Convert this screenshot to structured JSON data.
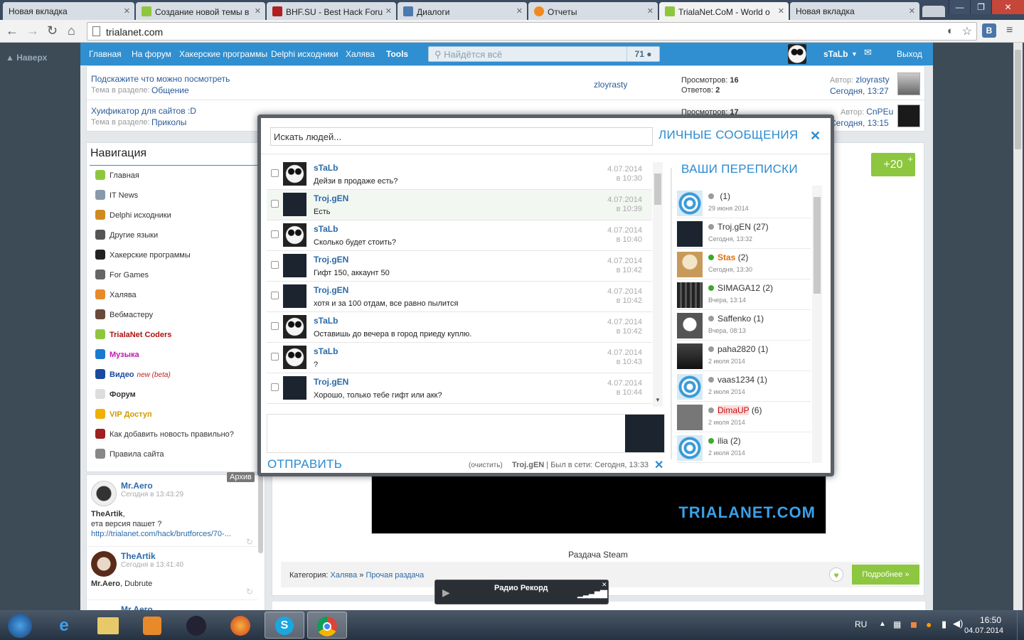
{
  "browser": {
    "tabs": [
      {
        "title": "Новая вкладка"
      },
      {
        "title": "Создание новой темы в"
      },
      {
        "title": "BHF.SU - Best Hack Foru"
      },
      {
        "title": "Диалоги"
      },
      {
        "title": "Отчеты"
      },
      {
        "title": "TrialaNet.CoM - World o"
      },
      {
        "title": "Новая вкладка"
      }
    ],
    "url": "trialanet.com",
    "ext_label": "В"
  },
  "site": {
    "back_to_top": "Наверх",
    "menu": [
      "Главная",
      "На форум",
      "Хакерские программы",
      "Delphi исходники",
      "Халява",
      "Tools"
    ],
    "search_placeholder": "Найдётся всё",
    "search_count": "71",
    "username": "sTaLb",
    "logout": "Выход",
    "topics": [
      {
        "title": "Подскажите что можно посмотреть",
        "section_prefix": "Тема в разделе:",
        "section": "Общение",
        "last_user": "zloyrasty",
        "views_label": "Просмотров:",
        "views": "16",
        "replies_label": "Ответов:",
        "replies": "2",
        "author_label": "Автор:",
        "author": "zloyrasty",
        "date": "Сегодня, 13:27"
      },
      {
        "title": "Хуификатор для сайтов :D",
        "section_prefix": "Тема в разделе:",
        "section": "Приколы",
        "last_user": "",
        "views_label": "Просмотров:",
        "views": "17",
        "replies_label": "",
        "replies": "",
        "author_label": "Автор:",
        "author": "CnPEu",
        "date": "Сегодня, 13:15"
      }
    ],
    "nav_title": "Навигация",
    "nav": [
      {
        "label": "Главная",
        "color": "#333"
      },
      {
        "label": "IT News",
        "color": "#333"
      },
      {
        "label": "Delphi исходники",
        "color": "#333"
      },
      {
        "label": "Другие языки",
        "color": "#333"
      },
      {
        "label": "Хакерские программы",
        "color": "#333"
      },
      {
        "label": "For Games",
        "color": "#333"
      },
      {
        "label": "Халява",
        "color": "#333"
      },
      {
        "label": "Вебмастеру",
        "color": "#333"
      },
      {
        "label": "TrialaNet Coders",
        "color": "#b01010"
      },
      {
        "label": "Музыка",
        "color": "#c01ab0"
      },
      {
        "label": "Видео",
        "color": "#1a4aa0"
      },
      {
        "label": "Форум",
        "color": "#333"
      },
      {
        "label": "VIP Доступ",
        "color": "#d09a00"
      },
      {
        "label": "Как добавить новость правильно?",
        "color": "#333"
      },
      {
        "label": "Правила сайта",
        "color": "#333"
      }
    ],
    "video_beta": "new (beta)",
    "chat_archive": "Архив",
    "chat": [
      {
        "user": "Mr.Aero",
        "time": "Сегодня в 13:43:29",
        "to": "TheArtik",
        "text": "ета версия пашет ?",
        "link": "http://trialanet.com/hack/brutforces/70-..."
      },
      {
        "user": "TheArtik",
        "time": "Сегодня в 13:41:40",
        "to": "Mr.Aero",
        "text": "Dubrute",
        "link": ""
      },
      {
        "user": "Mr.Aero",
        "time": "",
        "to": "",
        "text": "",
        "link": ""
      }
    ],
    "rating": "+20",
    "banner_text": "TRIALANET.COM",
    "post_caption": "Раздача Steam",
    "category_label": "Категория:",
    "category_path": [
      "Халява",
      "Прочая раздача"
    ],
    "more_button": "Подробнее »"
  },
  "dialog": {
    "search_placeholder": "Искать людей...",
    "title": "ЛИЧНЫЕ СООБЩЕНИЯ",
    "conversations_title": "ВАШИ ПЕРЕПИСКИ",
    "messages": [
      {
        "user": "sTaLb",
        "text": "Дейзи в продаже есть?",
        "date": "4.07.2014",
        "time": "в 10:30"
      },
      {
        "user": "Troj.gEN",
        "text": "Есть",
        "date": "4.07.2014",
        "time": "в 10:39"
      },
      {
        "user": "sTaLb",
        "text": "Сколько будет стоить?",
        "date": "4.07.2014",
        "time": "в 10:40"
      },
      {
        "user": "Troj.gEN",
        "text": "Гифт 150, аккаунт 50",
        "date": "4.07.2014",
        "time": "в 10:42"
      },
      {
        "user": "Troj.gEN",
        "text": "хотя и за 100 отдам, все равно пылится",
        "date": "4.07.2014",
        "time": "в 10:42"
      },
      {
        "user": "sTaLb",
        "text": "Оставишь до вечера в город приеду куплю.",
        "date": "4.07.2014",
        "time": "в 10:42"
      },
      {
        "user": "sTaLb",
        "text": "?",
        "date": "4.07.2014",
        "time": "в 10:43"
      },
      {
        "user": "Troj.gEN",
        "text": "Хорошо, только тебе гифт или акк?",
        "date": "4.07.2014",
        "time": "в 10:44"
      }
    ],
    "conversations": [
      {
        "name": "",
        "count": "(1)",
        "date": "29 июня 2014",
        "online": false
      },
      {
        "name": "Troj.gEN",
        "count": "(27)",
        "date": "Сегодня, 13:32",
        "online": false
      },
      {
        "name": "Stas",
        "count": "(2)",
        "date": "Сегодня, 13:30",
        "online": true
      },
      {
        "name": "SIMAGA12",
        "count": "(2)",
        "date": "Вчера, 13:14",
        "online": true
      },
      {
        "name": "Saffenko",
        "count": "(1)",
        "date": "Вчера, 08:13",
        "online": false
      },
      {
        "name": "paha2820",
        "count": "(1)",
        "date": "2 июля 2014",
        "online": false
      },
      {
        "name": "vaas1234",
        "count": "(1)",
        "date": "2 июля 2014",
        "online": false
      },
      {
        "name": "DimaUP",
        "count": "(6)",
        "date": "2 июля 2014",
        "online": false
      },
      {
        "name": "ilia",
        "count": "(2)",
        "date": "2 июля 2014",
        "online": true
      }
    ],
    "send_button": "ОТПРАВИТЬ",
    "clear_link": "(очистить)",
    "recipient": "Troj.gEN",
    "last_seen": "| Был в сети: Сегодня, 13:33"
  },
  "radio": {
    "title": "Радио Рекорд"
  },
  "taskbar": {
    "lang": "RU",
    "time": "16:50",
    "date": "04.07.2014"
  },
  "colors": {
    "site_blue": "#2f8fd0",
    "accent_green": "#8dc63f",
    "dialog_blue": "#2a8bd0"
  }
}
